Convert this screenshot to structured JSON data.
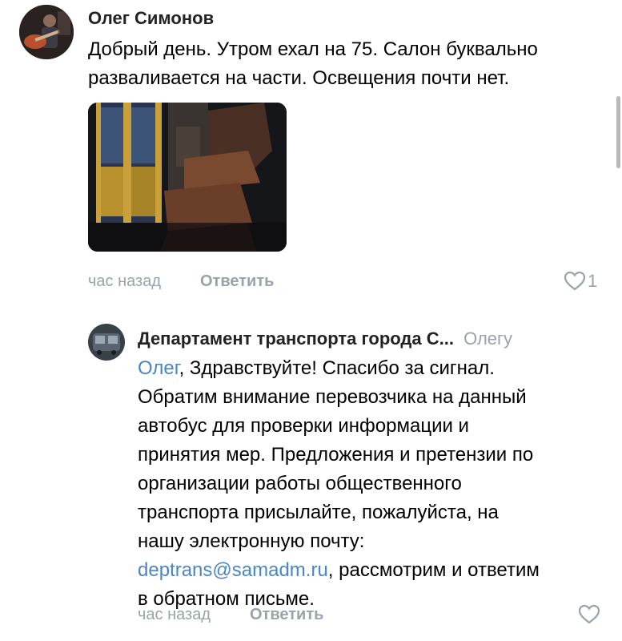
{
  "comments": [
    {
      "author": "Олег Симонов",
      "text_lines": [
        "Добрый день. Утром ехал на 75. Салон буквально",
        "разваливается на части. Освещения почти нет."
      ],
      "time": "час назад",
      "reply_label": "Ответить",
      "likes": "1",
      "avatar_icon": "user-avatar-guitar",
      "photo_icon": "bus-interior-photo"
    },
    {
      "author": "Департамент транспорта города С...",
      "reply_to": "Олегу",
      "mention": "Олег",
      "text_first": ", Здравствуйте! Спасибо за сигнал.",
      "text_lines": [
        "Обратим внимание перевозчика на данный",
        "автобус для проверки информации и",
        "принятия мер. Предложения и претензии по",
        "организации работы общественного",
        "транспорта присылайте, пожалуйста, на",
        "нашу электронную почту:"
      ],
      "email": "deptrans@samadm.ru",
      "email_tail": ", рассмотрим и ответим",
      "last_line": "в обратном письме.",
      "time": "час назад",
      "reply_label": "Ответить",
      "avatar_icon": "bus-avatar"
    }
  ],
  "colors": {
    "link": "#4a86c5",
    "meta": "#99a2ad",
    "text": "#000000"
  }
}
